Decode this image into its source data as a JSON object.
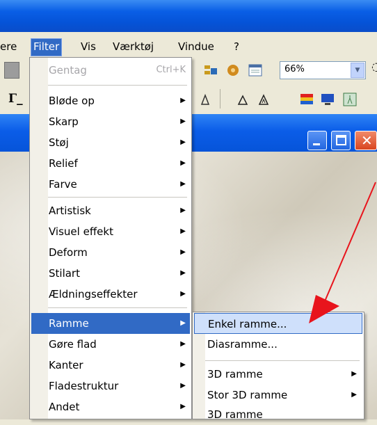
{
  "menubar": {
    "items": [
      {
        "label": "ere"
      },
      {
        "label": "Filter"
      },
      {
        "label": "Vis"
      },
      {
        "label": "Værktøj"
      },
      {
        "label": "Vindue"
      },
      {
        "label": "?"
      }
    ]
  },
  "toolbar": {
    "zoom_value": "66%",
    "tool_glyph": "Γ_"
  },
  "filter_menu": {
    "repeat": {
      "label": "Gentag",
      "shortcut": "Ctrl+K"
    },
    "group1": [
      "Bløde op",
      "Skarp",
      "Støj",
      "Relief",
      "Farve"
    ],
    "group2": [
      "Artistisk",
      "Visuel effekt",
      "Deform",
      "Stilart",
      "Ældningseffekter"
    ],
    "group3": [
      "Ramme",
      "Gøre flad",
      "Kanter",
      "Fladestruktur",
      "Andet"
    ]
  },
  "ramme_submenu": {
    "items": [
      "Enkel ramme...",
      "Diasramme...",
      "3D ramme",
      "Stor 3D ramme",
      "3D ramme"
    ]
  },
  "colors": {
    "highlight": "#316ac5",
    "arrow": "#e8141c",
    "titlebar": "#0a5fe6"
  }
}
